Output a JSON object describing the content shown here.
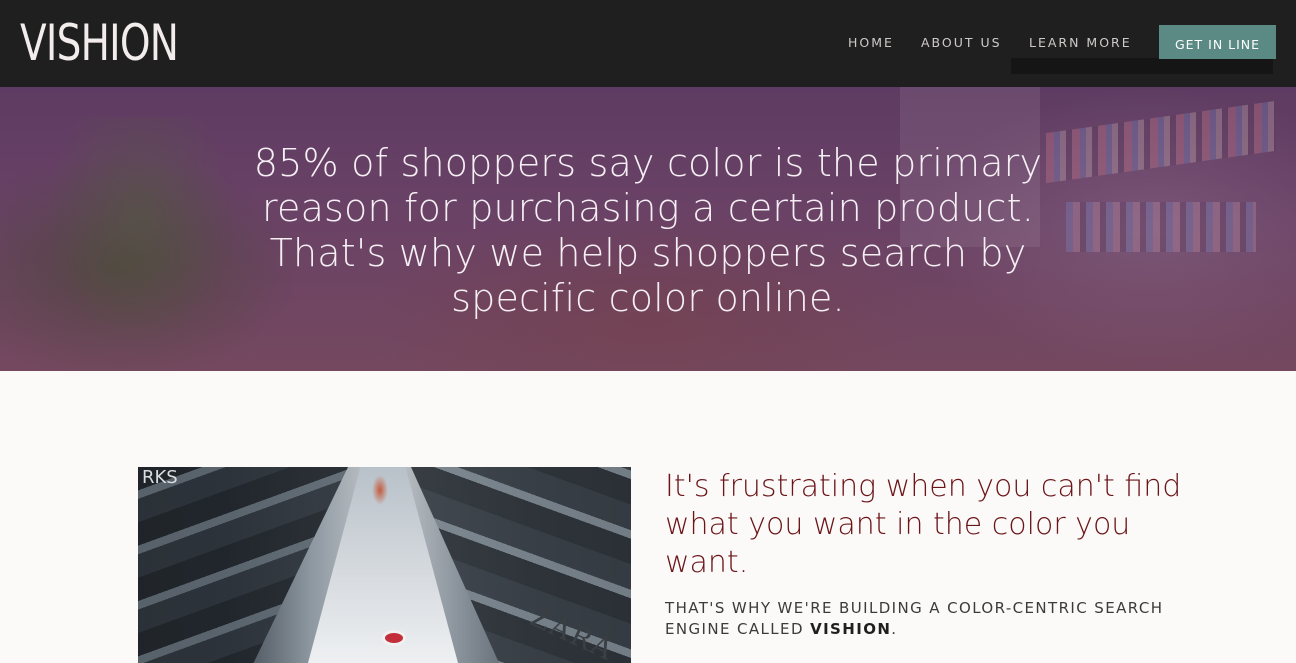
{
  "header": {
    "logo": "VISHION",
    "nav": {
      "home": "HOME",
      "about": "ABOUT US",
      "learn": "LEARN MORE"
    },
    "cta_label": "GET IN LINE",
    "cta_color": "#5b8a85"
  },
  "hero": {
    "text": "85% of shoppers say color is the primary reason for purchasing a certain product. That's why we help shoppers search by specific color online."
  },
  "content": {
    "headline": "It's frustrating when you can't find what you want in the color you want.",
    "subtext_prefix": "THAT'S WHY WE'RE BUILDING A COLOR-CENTRIC SEARCH ENGINE CALLED ",
    "subtext_brand": "VISHION",
    "subtext_suffix": ".",
    "photo": {
      "sign_left": "RKS",
      "sign_right": "ZARA"
    }
  },
  "colors": {
    "header_bg": "#1f1f1f",
    "hero_overlay": "#6a4266",
    "headline": "#6b1518",
    "page_bg": "#fcfaf9"
  }
}
